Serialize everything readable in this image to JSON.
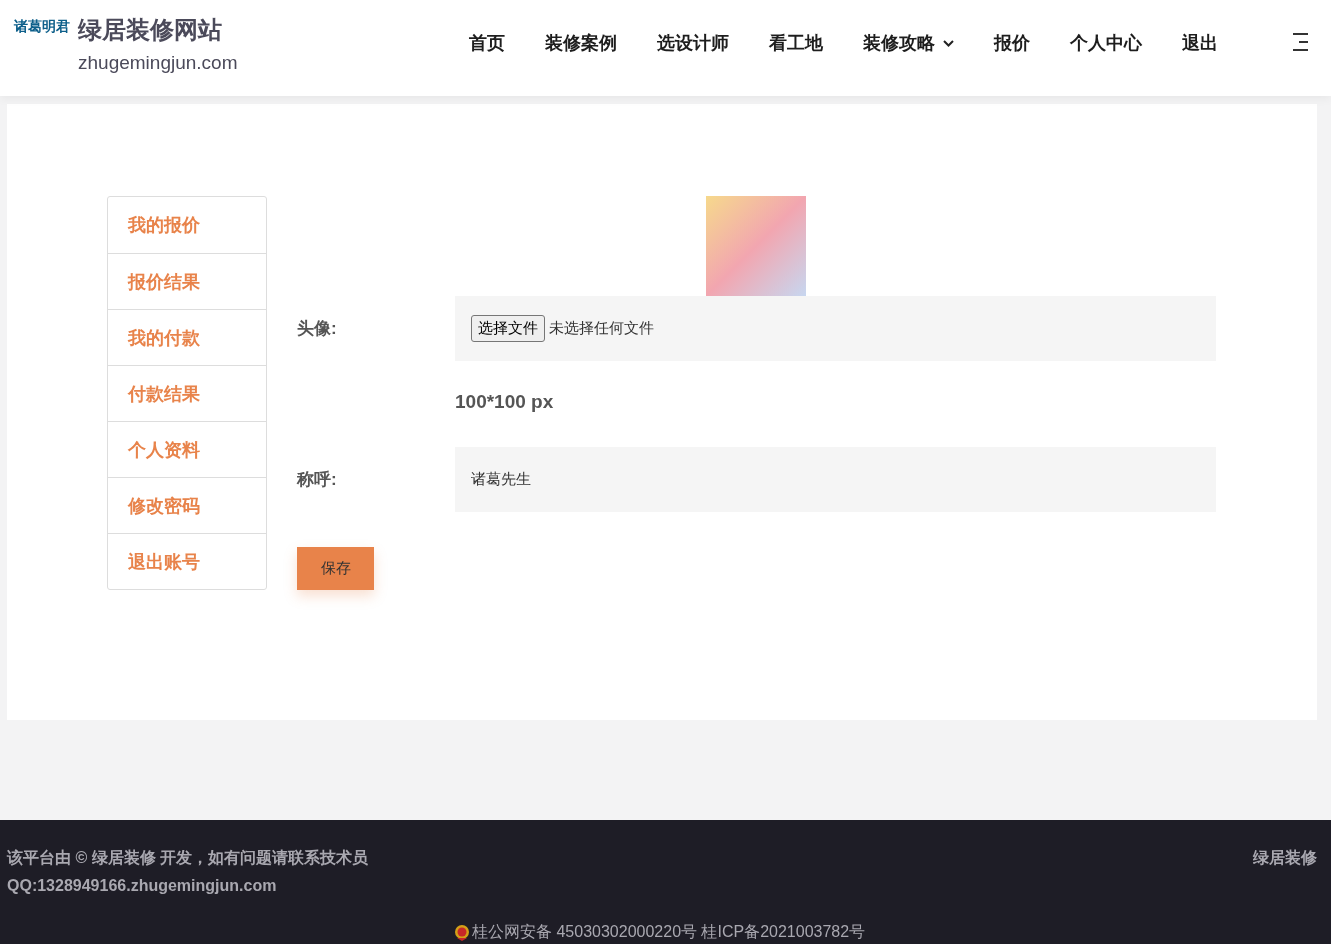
{
  "header": {
    "brand_small": "诸葛明君",
    "brand_title": "绿居装修网站",
    "domain": "zhugemingjun.com",
    "nav": [
      {
        "label": "首页",
        "dropdown": false
      },
      {
        "label": "装修案例",
        "dropdown": false
      },
      {
        "label": "选设计师",
        "dropdown": false
      },
      {
        "label": "看工地",
        "dropdown": false
      },
      {
        "label": "装修攻略",
        "dropdown": true
      },
      {
        "label": "报价",
        "dropdown": false
      },
      {
        "label": "个人中心",
        "dropdown": false
      },
      {
        "label": "退出",
        "dropdown": false
      }
    ]
  },
  "sidebar": {
    "items": [
      "我的报价",
      "报价结果",
      "我的付款",
      "付款结果",
      "个人资料",
      "修改密码",
      "退出账号"
    ]
  },
  "form": {
    "avatar_label": "头像:",
    "file_button": "选择文件",
    "file_status": "未选择任何文件",
    "size_hint": "100*100 px",
    "name_label": "称呼:",
    "name_value": "诸葛先生",
    "save_button": "保存"
  },
  "footer": {
    "line_1": "该平台由 © 绿居装修 开发，如有问题请联系技术员",
    "line_2": "QQ:1328949166.zhugemingjun.com",
    "right": "绿居装修",
    "record": "桂公网安备 45030302000220号 桂ICP备2021003782号"
  }
}
